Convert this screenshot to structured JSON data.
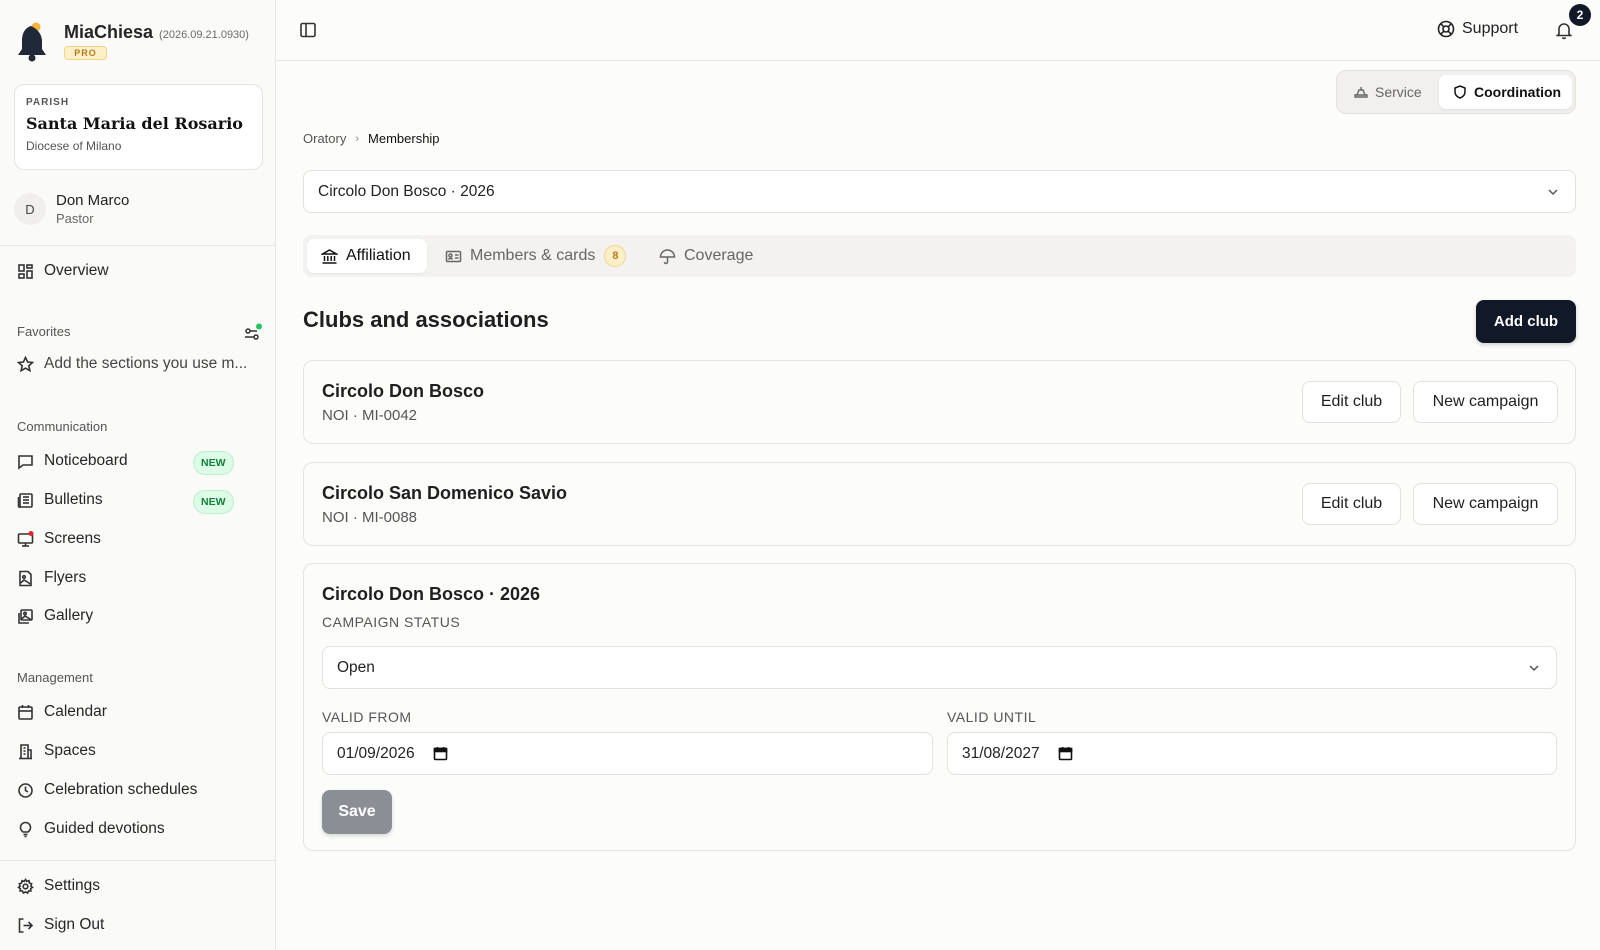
{
  "app": {
    "name": "MiaChiesa",
    "version": "(2026.09.21.0930)",
    "plan_badge": "PRO"
  },
  "parish": {
    "label": "PARISH",
    "name": "Santa Maria del Rosario",
    "diocese": "Diocese of Milano"
  },
  "user": {
    "initial": "D",
    "name": "Don Marco",
    "role": "Pastor"
  },
  "sidebar": {
    "overview": "Overview",
    "favorites_title": "Favorites",
    "favorites_hint": "Add the sections you use m...",
    "communication_title": "Communication",
    "communication_items": [
      {
        "label": "Noticeboard",
        "badge": "NEW"
      },
      {
        "label": "Bulletins",
        "badge": "NEW"
      },
      {
        "label": "Screens"
      },
      {
        "label": "Flyers"
      },
      {
        "label": "Gallery"
      }
    ],
    "management_title": "Management",
    "management_items": [
      {
        "label": "Calendar"
      },
      {
        "label": "Spaces"
      },
      {
        "label": "Celebration schedules"
      },
      {
        "label": "Guided devotions"
      }
    ],
    "settings": "Settings",
    "sign_out": "Sign Out"
  },
  "topbar": {
    "support": "Support",
    "notifications_count": "2"
  },
  "mode_switch": {
    "service": "Service",
    "coordination": "Coordination",
    "active": "coordination"
  },
  "breadcrumb": {
    "parent": "Oratory",
    "current": "Membership"
  },
  "campaign_selector": {
    "value": "Circolo Don Bosco · 2026"
  },
  "tabs": [
    {
      "label": "Affiliation",
      "active": true
    },
    {
      "label": "Members & cards",
      "count": "8"
    },
    {
      "label": "Coverage"
    }
  ],
  "main": {
    "section_title": "Clubs and associations",
    "add_club": "Add club",
    "clubs": [
      {
        "name": "Circolo Don Bosco",
        "code": "NOI · MI-0042",
        "edit": "Edit club",
        "new_campaign": "New campaign"
      },
      {
        "name": "Circolo San Domenico Savio",
        "code": "NOI · MI-0088",
        "edit": "Edit club",
        "new_campaign": "New campaign"
      }
    ],
    "campaign": {
      "title": "Circolo Don Bosco · 2026",
      "status_label": "CAMPAIGN STATUS",
      "status_value": "Open",
      "valid_from_label": "VALID FROM",
      "valid_from": "01/09/2026",
      "valid_until_label": "VALID UNTIL",
      "valid_until": "31/08/2027",
      "save": "Save"
    }
  },
  "colors": {
    "primary_dark": "#111827",
    "new_badge_green": "#15803d",
    "pro_gold": "#b7791f",
    "online_dot": "#22c55e",
    "alert_dot": "#dc2626"
  }
}
